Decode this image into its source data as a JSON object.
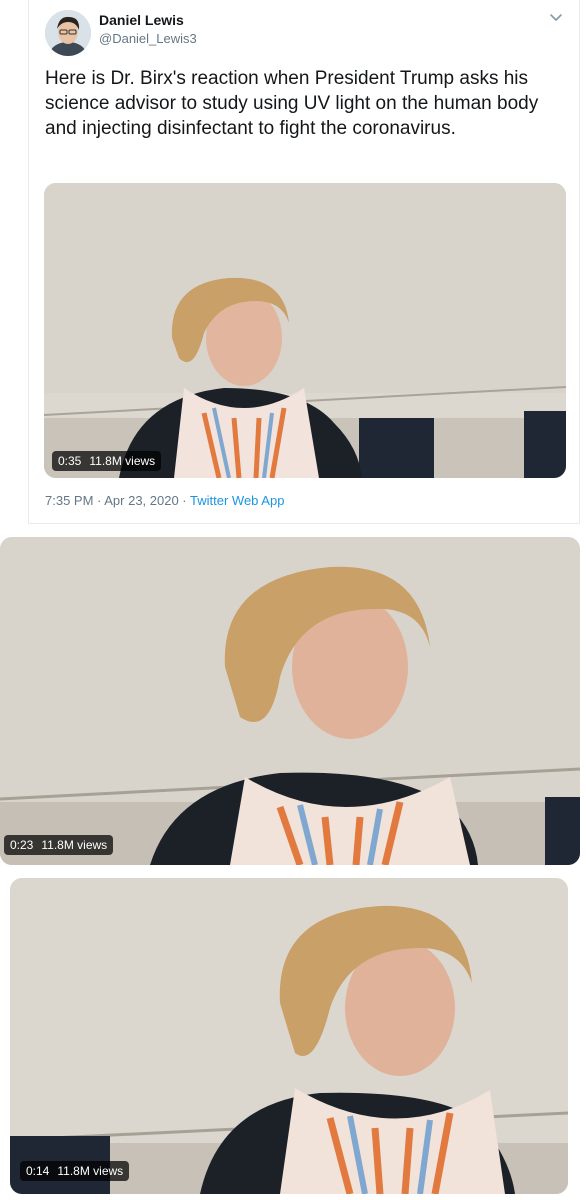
{
  "tweet": {
    "author_name": "Daniel Lewis",
    "author_handle": "@Daniel_Lewis3",
    "text": "Here is Dr. Birx's reaction when President Trump asks his science advisor to study using UV light on the human body and injecting disinfectant to fight the coronavirus.",
    "timestamp": "7:35 PM · Apr 23, 2020 · ",
    "source": "Twitter Web App"
  },
  "videos": [
    {
      "duration": "0:35",
      "views": "11.8M views"
    },
    {
      "duration": "0:23",
      "views": "11.8M views"
    },
    {
      "duration": "0:14",
      "views": "11.8M views"
    }
  ],
  "icons": {
    "avatar": "avatar",
    "menu": "chevron-down-icon"
  },
  "colors": {
    "handle": "#657786",
    "link": "#1b95e0",
    "border": "#e6ecf0"
  }
}
